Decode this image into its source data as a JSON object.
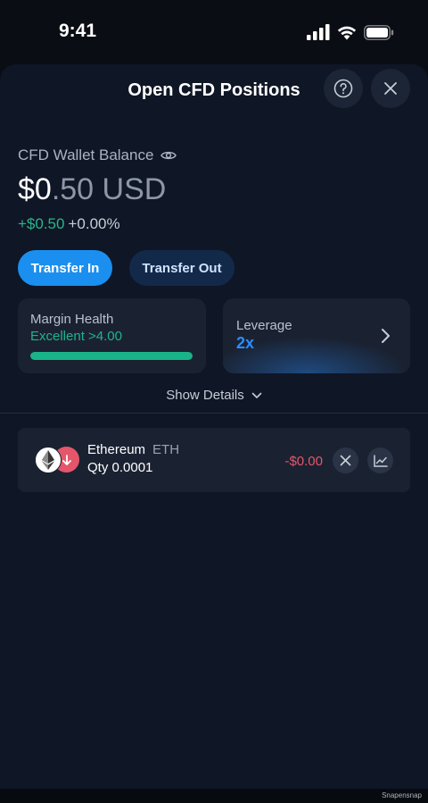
{
  "status_bar": {
    "time": "9:41",
    "icons": [
      "signal-icon",
      "wifi-icon",
      "battery-icon"
    ]
  },
  "header": {
    "title": "Open CFD Positions",
    "help_icon": "question-circle-icon",
    "close_icon": "close-icon"
  },
  "wallet": {
    "label": "CFD Wallet Balance",
    "visibility_icon": "eye-icon",
    "balance_int": "$0",
    "balance_dec": ".50 USD",
    "pnl_amount": "+$0.50",
    "pnl_percent": "+0.00%"
  },
  "actions": {
    "transfer_in": "Transfer In",
    "transfer_out": "Transfer Out"
  },
  "margin": {
    "label": "Margin Health",
    "status": "Excellent >4.00",
    "health_fraction": 1.0
  },
  "leverage": {
    "label": "Leverage",
    "value": "2x"
  },
  "details": {
    "label": "Show Details"
  },
  "positions": [
    {
      "name": "Ethereum",
      "ticker": "ETH",
      "qty": "Qty 0.0001",
      "pnl": "-$0.00",
      "direction": "short",
      "coin_icon": "ethereum-icon"
    }
  ],
  "watermark": "Snapensnap",
  "colors": {
    "accent": "#1a8fef",
    "positive": "#2bb58a",
    "negative": "#e5566a",
    "background": "#0f1626"
  }
}
